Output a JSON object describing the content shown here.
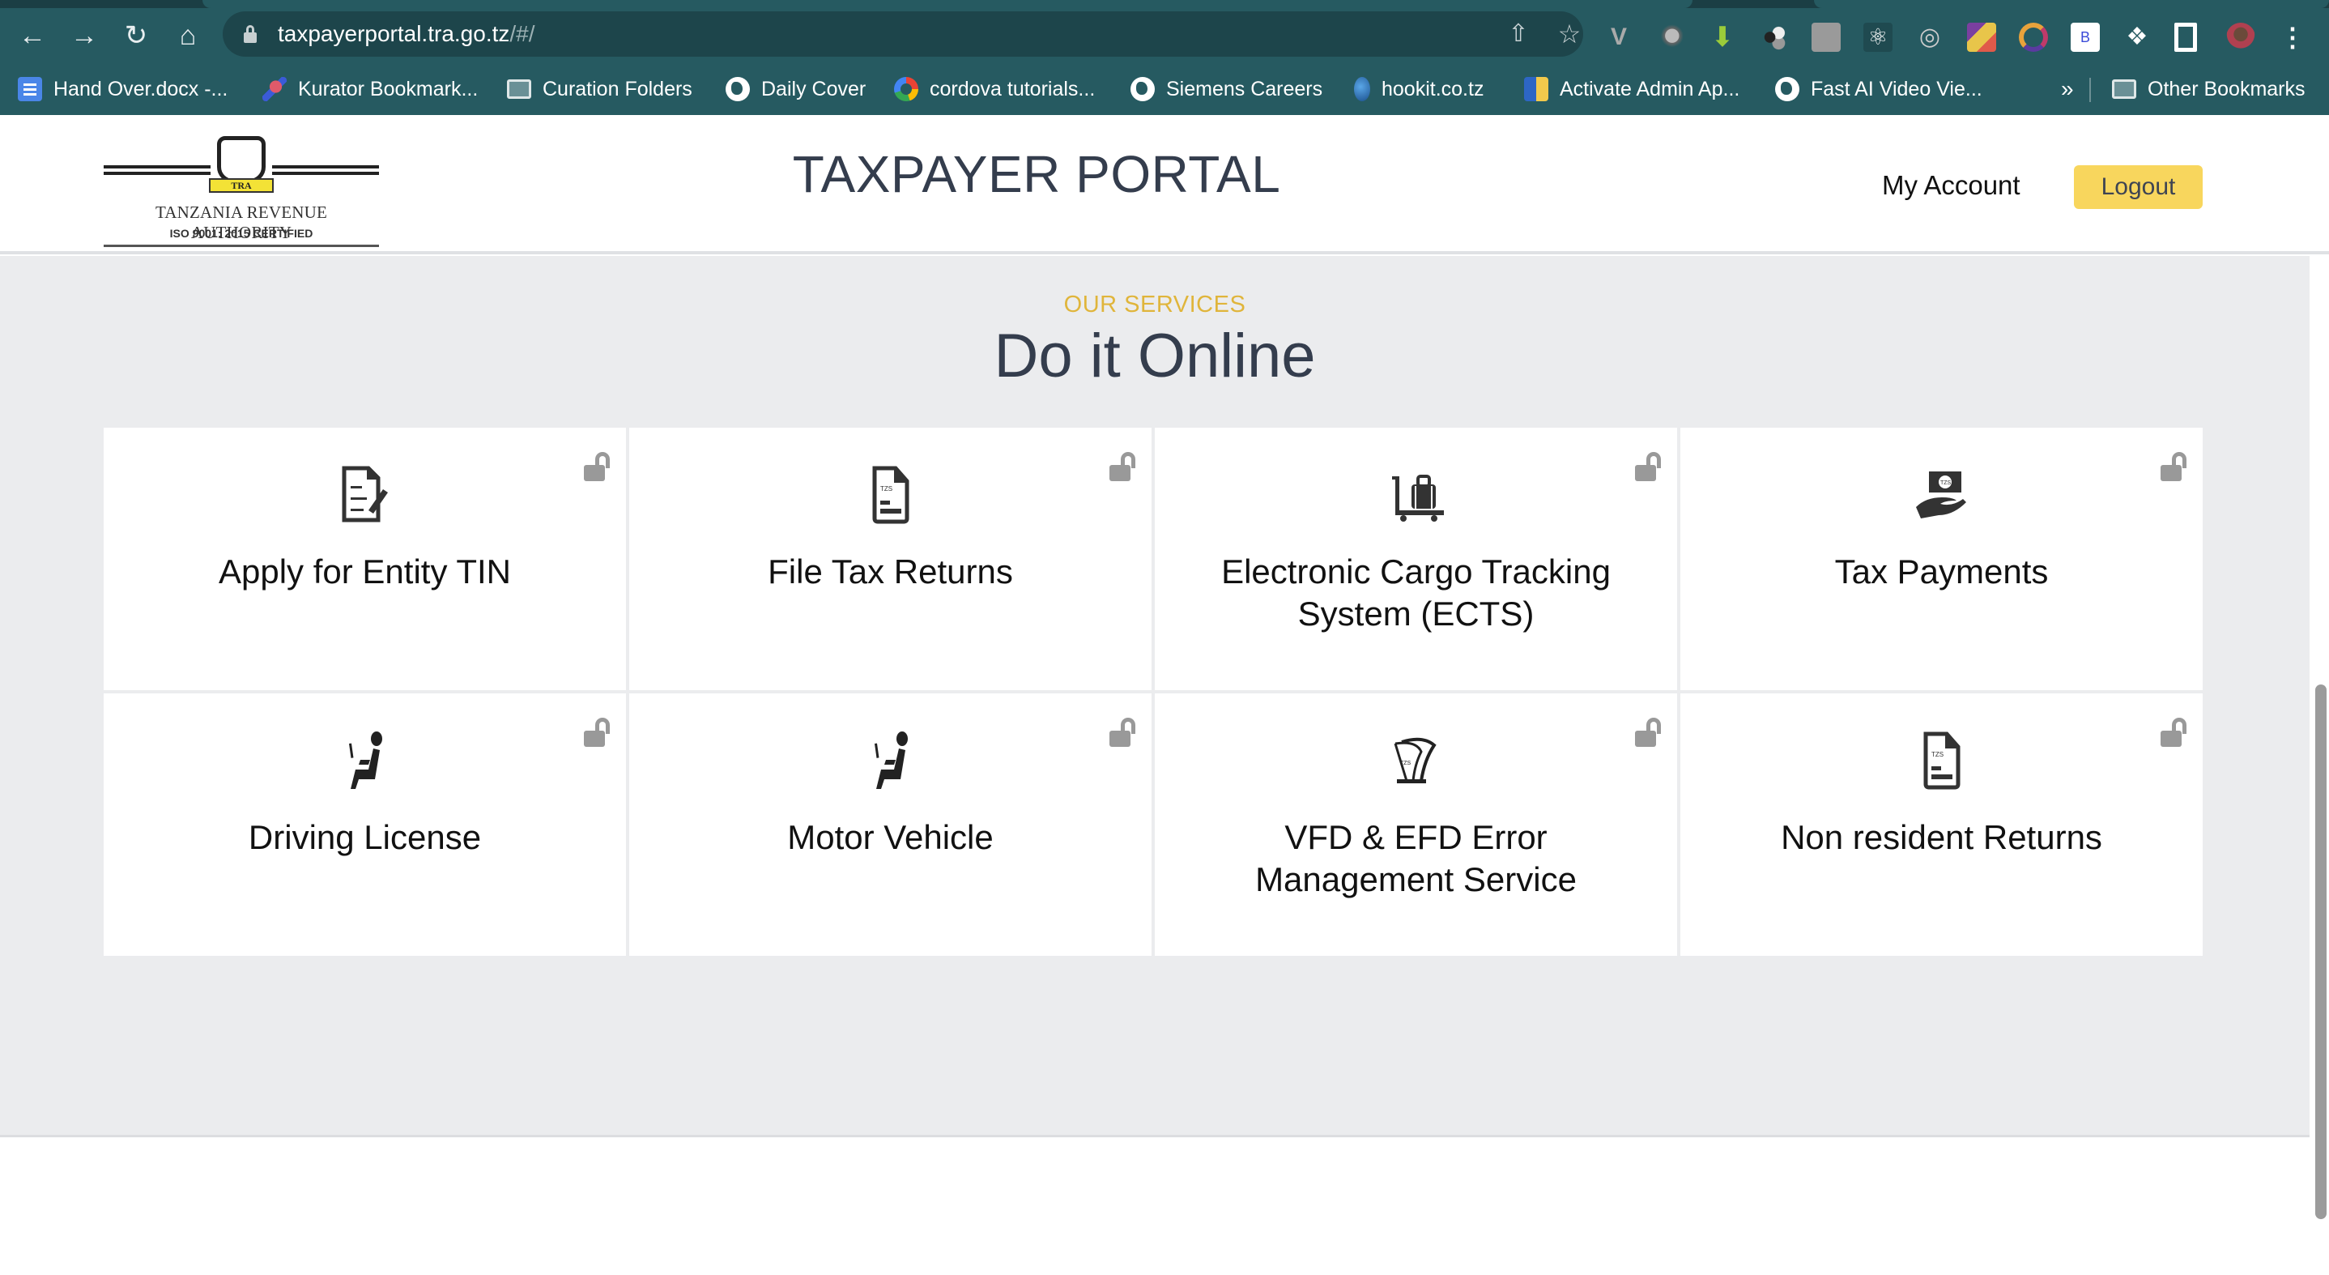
{
  "browser": {
    "nav": {
      "back_icon": "arrow-left-icon",
      "forward_icon": "arrow-right-icon",
      "reload_icon": "reload-icon",
      "home_icon": "home-icon"
    },
    "url": {
      "host": "taxpayerportal.tra.go.tz",
      "path": "/#/"
    },
    "url_actions": [
      "share-icon",
      "star-icon"
    ],
    "extensions": [
      "vue-devtools",
      "kurator",
      "download-helper",
      "molecule",
      "touch",
      "react-devtools",
      "target",
      "colorful-app",
      "ring-app",
      "b-extension",
      "puzzle-extensions",
      "sidebar-panel",
      "profile-avatar",
      "kebab-menu"
    ],
    "bookmarks": [
      {
        "label": "Hand Over.docx -...",
        "icon": "google-docs-icon"
      },
      {
        "label": "Kurator Bookmark...",
        "icon": "kurator-icon"
      },
      {
        "label": "Curation Folders",
        "icon": "folder-icon"
      },
      {
        "label": "Daily Cover",
        "icon": "globe-icon"
      },
      {
        "label": "cordova tutorials...",
        "icon": "google-icon"
      },
      {
        "label": "Siemens Careers",
        "icon": "globe-icon"
      },
      {
        "label": "hookit.co.tz",
        "icon": "hookit-icon"
      },
      {
        "label": "Activate Admin Ap...",
        "icon": "app-icon"
      },
      {
        "label": "Fast AI Video Vie...",
        "icon": "globe-icon"
      }
    ],
    "more_bookmarks": "»",
    "other_bookmarks": "Other Bookmarks"
  },
  "header": {
    "logo": {
      "org_name": "TANZANIA REVENUE AUTHORITY",
      "certification": "ISO 9001: 2015 CERTIFIED",
      "ribbon": "TRA"
    },
    "title": "TAXPAYER PORTAL",
    "my_account": "My Account",
    "logout": "Logout"
  },
  "services": {
    "eyebrow": "OUR SERVICES",
    "title": "Do it Online",
    "accent_color": "#e0b53b",
    "items": [
      {
        "label": "Apply for Entity TIN",
        "icon": "document-edit-icon",
        "lock": "unlocked"
      },
      {
        "label": "File Tax Returns",
        "icon": "tzs-document-icon",
        "lock": "unlocked"
      },
      {
        "label": "Electronic Cargo Tracking System (ECTS)",
        "icon": "luggage-cart-icon",
        "lock": "unlocked"
      },
      {
        "label": "Tax Payments",
        "icon": "hand-money-icon",
        "lock": "unlocked"
      },
      {
        "label": "Driving License",
        "icon": "driver-seat-icon",
        "lock": "unlocked"
      },
      {
        "label": "Motor Vehicle",
        "icon": "driver-seat-icon",
        "lock": "unlocked"
      },
      {
        "label": "VFD & EFD Error Management Service",
        "icon": "receipt-printer-icon",
        "lock": "unlocked"
      },
      {
        "label": "Non resident Returns",
        "icon": "tzs-document-icon",
        "lock": "unlocked"
      }
    ]
  }
}
